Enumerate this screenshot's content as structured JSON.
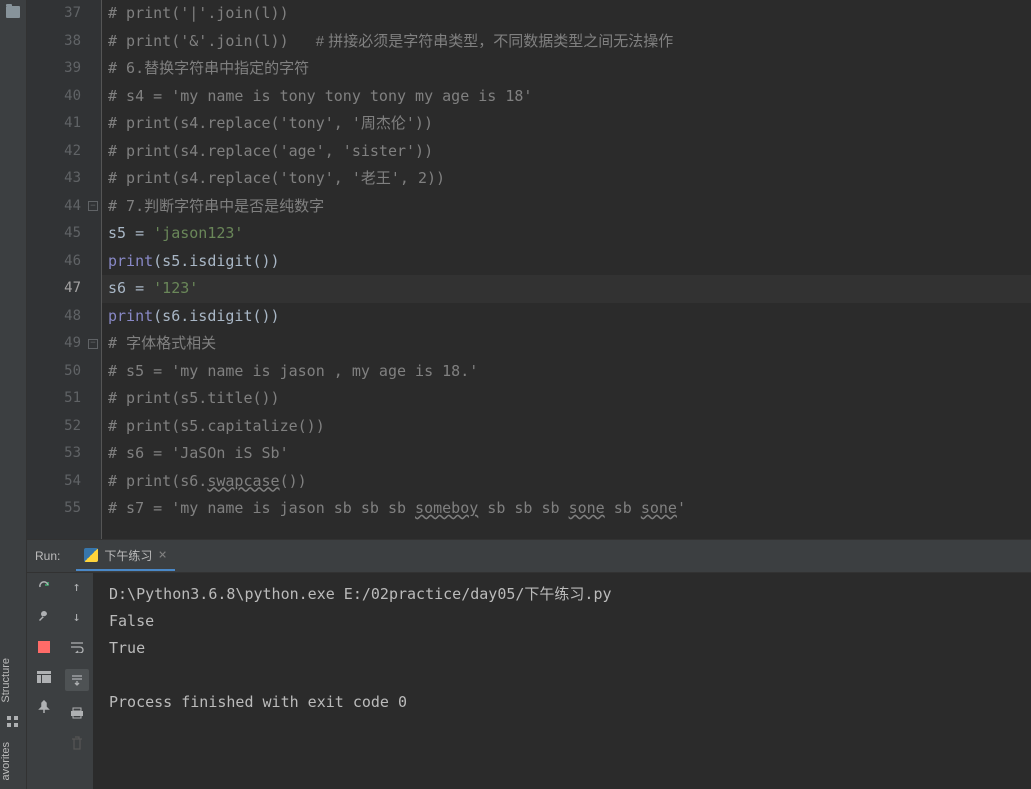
{
  "sidebar": {
    "structure_label": "Structure",
    "favorites_label": "avorites"
  },
  "editor": {
    "lines": [
      {
        "num": 37,
        "tokens": [
          {
            "t": "# print('|'.join(l))",
            "c": "comment"
          }
        ]
      },
      {
        "num": 38,
        "tokens": [
          {
            "t": "# print('&'.join(l))   ",
            "c": "comment"
          },
          {
            "t": "# 拼接必须是字符串类型，不同数据类型之间无法操作",
            "c": "cn-comment"
          }
        ]
      },
      {
        "num": 39,
        "tokens": [
          {
            "t": "# 6.",
            "c": "comment"
          },
          {
            "t": "替换字符串中指定的字符",
            "c": "cn-comment"
          }
        ]
      },
      {
        "num": 40,
        "tokens": [
          {
            "t": "# s4 = 'my name is tony tony tony my age is 18'",
            "c": "comment"
          }
        ]
      },
      {
        "num": 41,
        "tokens": [
          {
            "t": "# print(s4.replace('tony', '",
            "c": "comment"
          },
          {
            "t": "周杰伦",
            "c": "cn-comment"
          },
          {
            "t": "'))",
            "c": "comment"
          }
        ]
      },
      {
        "num": 42,
        "tokens": [
          {
            "t": "# print(s4.replace('age', 'sister'))",
            "c": "comment"
          }
        ]
      },
      {
        "num": 43,
        "tokens": [
          {
            "t": "# print(s4.replace('tony', '",
            "c": "comment"
          },
          {
            "t": "老王",
            "c": "cn-comment"
          },
          {
            "t": "', 2))",
            "c": "comment"
          }
        ]
      },
      {
        "num": 44,
        "fold": true,
        "noindent": true,
        "tokens": [
          {
            "t": "# 7.",
            "c": "comment"
          },
          {
            "t": "判断字符串中是否是纯数字",
            "c": "cn-comment"
          }
        ]
      },
      {
        "num": 45,
        "tokens": [
          {
            "t": "s5 = ",
            "c": "identifier"
          },
          {
            "t": "'jason123'",
            "c": "string"
          }
        ]
      },
      {
        "num": 46,
        "tokens": [
          {
            "t": "print",
            "c": "keyword"
          },
          {
            "t": "(s5.isdigit())",
            "c": "identifier"
          }
        ]
      },
      {
        "num": 47,
        "current": true,
        "tokens": [
          {
            "t": "s6 = ",
            "c": "identifier"
          },
          {
            "t": "'123'",
            "c": "string"
          }
        ]
      },
      {
        "num": 48,
        "tokens": [
          {
            "t": "print",
            "c": "keyword"
          },
          {
            "t": "(s6.isdigit())",
            "c": "identifier"
          }
        ]
      },
      {
        "num": 49,
        "fold": true,
        "noindent": true,
        "tokens": [
          {
            "t": "# ",
            "c": "comment"
          },
          {
            "t": "字体格式相关",
            "c": "cn-comment"
          }
        ]
      },
      {
        "num": 50,
        "tokens": [
          {
            "t": "# s5 = 'my name is jason , my age is 18.'",
            "c": "comment"
          }
        ]
      },
      {
        "num": 51,
        "tokens": [
          {
            "t": "# print(s5.title())",
            "c": "comment"
          }
        ]
      },
      {
        "num": 52,
        "tokens": [
          {
            "t": "# print(s5.capitalize())",
            "c": "comment"
          }
        ]
      },
      {
        "num": 53,
        "tokens": [
          {
            "t": "# s6 = 'JaSOn iS Sb'",
            "c": "comment"
          }
        ]
      },
      {
        "num": 54,
        "tokens": [
          {
            "t": "# print(s6.",
            "c": "comment"
          },
          {
            "t": "swapcase",
            "c": "comment wavy"
          },
          {
            "t": "())",
            "c": "comment"
          }
        ]
      },
      {
        "num": 55,
        "tokens": [
          {
            "t": "# s7 = 'my name is jason sb sb sb ",
            "c": "comment"
          },
          {
            "t": "someboy",
            "c": "comment wavy"
          },
          {
            "t": " sb sb sb ",
            "c": "comment"
          },
          {
            "t": "sone",
            "c": "comment wavy"
          },
          {
            "t": " sb ",
            "c": "comment"
          },
          {
            "t": "sone",
            "c": "comment wavy"
          },
          {
            "t": "'",
            "c": "comment"
          }
        ]
      }
    ]
  },
  "run": {
    "label": "Run:",
    "tab_name": "下午练习",
    "output": [
      "D:\\Python3.6.8\\python.exe E:/02practice/day05/下午练习.py",
      "False",
      "True",
      "",
      "Process finished with exit code 0"
    ]
  }
}
